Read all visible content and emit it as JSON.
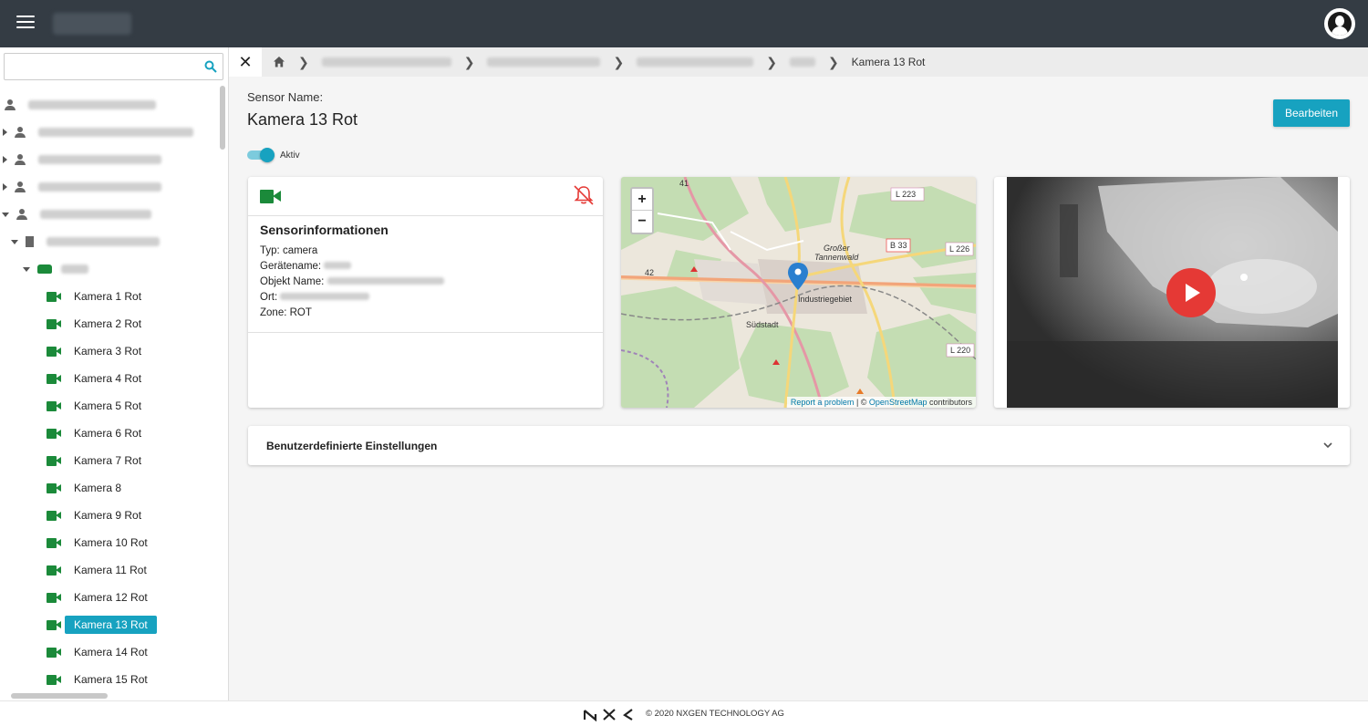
{
  "header": {
    "menu_icon": "hamburger-icon",
    "avatar_icon": "user-avatar-icon"
  },
  "sidebar": {
    "search": {
      "placeholder": "",
      "value": "",
      "icon": "search-icon"
    },
    "tree": [
      {
        "type": "customer",
        "label": "",
        "level": 0
      },
      {
        "type": "customer",
        "label": "",
        "level": 0,
        "collapsed": true
      },
      {
        "type": "customer",
        "label": "",
        "level": 0,
        "collapsed": true
      },
      {
        "type": "customer",
        "label": "",
        "level": 0,
        "collapsed": true
      },
      {
        "type": "customer",
        "label": "",
        "level": 0,
        "expanded": true
      },
      {
        "type": "site",
        "label": "",
        "level": 1,
        "expanded": true
      },
      {
        "type": "zone",
        "label": "",
        "level": 2,
        "expanded": true
      }
    ],
    "cameras": [
      "Kamera 1 Rot",
      "Kamera 2 Rot",
      "Kamera 3 Rot",
      "Kamera 4 Rot",
      "Kamera 5 Rot",
      "Kamera 6 Rot",
      "Kamera 7 Rot",
      "Kamera 8",
      "Kamera 9 Rot",
      "Kamera 10 Rot",
      "Kamera 11 Rot",
      "Kamera 12 Rot",
      "Kamera 13 Rot",
      "Kamera 14 Rot",
      "Kamera 15 Rot"
    ],
    "selected_camera": "Kamera 13 Rot"
  },
  "breadcrumb": {
    "close_icon": "close-icon",
    "home_icon": "home-icon",
    "current": "Kamera 13 Rot"
  },
  "sensor": {
    "name_label": "Sensor Name:",
    "name": "Kamera 13 Rot",
    "edit_label": "Bearbeiten",
    "active_label": "Aktiv",
    "active": true
  },
  "info": {
    "title": "Sensorinformationen",
    "type_label": "Typ:",
    "type_value": "camera",
    "device_label": "Gerätename:",
    "object_label": "Objekt Name:",
    "location_label": "Ort:",
    "zone_label": "Zone:",
    "zone_value": "ROT"
  },
  "map": {
    "zoom_in": "+",
    "zoom_out": "−",
    "report": "Report a problem",
    "separator": " | © ",
    "osm": "OpenStreetMap",
    "contributors": " contributors",
    "labels": {
      "industrie": "Industriegebiet",
      "suedstadt": "Südstadt",
      "tannenwald1": "Großer",
      "tannenwald2": "Tannenwald",
      "l223": "L 223",
      "b33": "B 33",
      "l226": "L 226",
      "l220": "L 220",
      "n41": "41",
      "n42": "42"
    }
  },
  "video": {
    "play_icon": "play-icon"
  },
  "accordion": {
    "title": "Benutzerdefinierte Einstellungen"
  },
  "footer": {
    "copyright": "© 2020 NXGEN TECHNOLOGY AG"
  },
  "colors": {
    "accent": "#17a2c0",
    "topbar": "#343c44",
    "camera_green": "#1b8a3a",
    "alert_red": "#e53935"
  }
}
